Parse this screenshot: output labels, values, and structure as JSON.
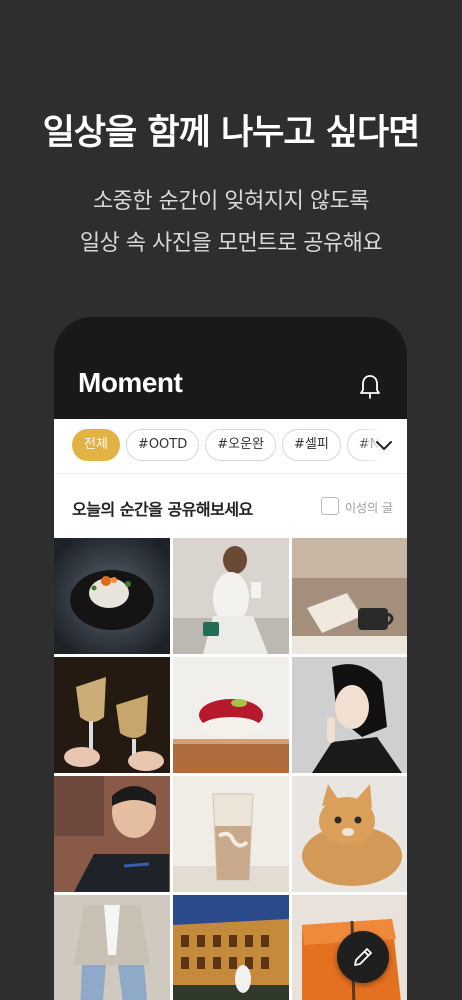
{
  "promo": {
    "headline": "일상을 함께 나누고 싶다면",
    "sub1": "소중한 순간이 잊혀지지 않도록",
    "sub2": "일상 속 사진을 모먼트로 공유해요"
  },
  "app": {
    "title": "Moment",
    "tags": [
      "전체",
      "#OOTD",
      "#오운완",
      "#셀피",
      "#NOW"
    ],
    "active_tag": "전체",
    "compose_prompt": "오늘의 순간을 공유해보세요",
    "opposite_sex_label": "이성의 글"
  },
  "colors": {
    "accent": "#e2b343",
    "background": "#2e2e2e",
    "app_header": "#191919"
  },
  "photos": [
    "sushi-dish",
    "woman-cafe",
    "book-coffee",
    "wine-toast",
    "tuna-sushi",
    "woman-portrait",
    "man-selfie",
    "iced-latte",
    "orange-cat",
    "fashion-outfit",
    "colosseum-night",
    "hermes-box"
  ],
  "icons": [
    "bell-icon",
    "chevron-down-icon",
    "pencil-icon"
  ]
}
